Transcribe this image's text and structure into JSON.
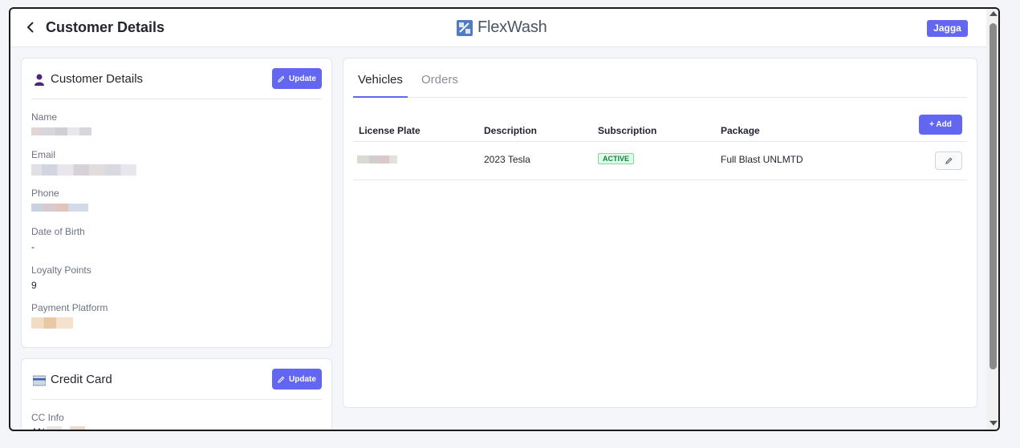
{
  "header": {
    "page_title": "Customer Details",
    "brand_name": "FlexWash",
    "user_button": "Jagga"
  },
  "customer_card": {
    "title": "Customer Details",
    "update_label": "Update",
    "fields": [
      {
        "label": "Name",
        "value": ""
      },
      {
        "label": "Email",
        "value": ""
      },
      {
        "label": "Phone",
        "value": ""
      },
      {
        "label": "Date of Birth",
        "value": "-"
      },
      {
        "label": "Loyalty Points",
        "value": "9"
      },
      {
        "label": "Payment Platform",
        "value": ""
      }
    ]
  },
  "credit_card": {
    "title": "Credit Card",
    "update_label": "Update",
    "fields": [
      {
        "label": "CC Info",
        "value": "AN"
      }
    ]
  },
  "tabs": [
    {
      "label": "Vehicles",
      "active": true
    },
    {
      "label": "Orders",
      "active": false
    }
  ],
  "vehicles": {
    "add_label": "+ Add",
    "columns": [
      "License Plate",
      "Description",
      "Subscription",
      "Package"
    ],
    "rows": [
      {
        "license_plate": "",
        "description": "2023 Tesla",
        "subscription": "ACTIVE",
        "package": "Full Blast UNLMTD"
      }
    ]
  },
  "colors": {
    "accent": "#6366f1",
    "active_badge_bg": "#dcfce7",
    "active_badge_text": "#15803d"
  },
  "icons": {
    "back": "chevron-left-icon",
    "brand": "flexwash-logo-icon",
    "customer": "person-icon",
    "card": "credit-card-icon",
    "update": "pencil-icon",
    "edit": "pencil-icon"
  }
}
